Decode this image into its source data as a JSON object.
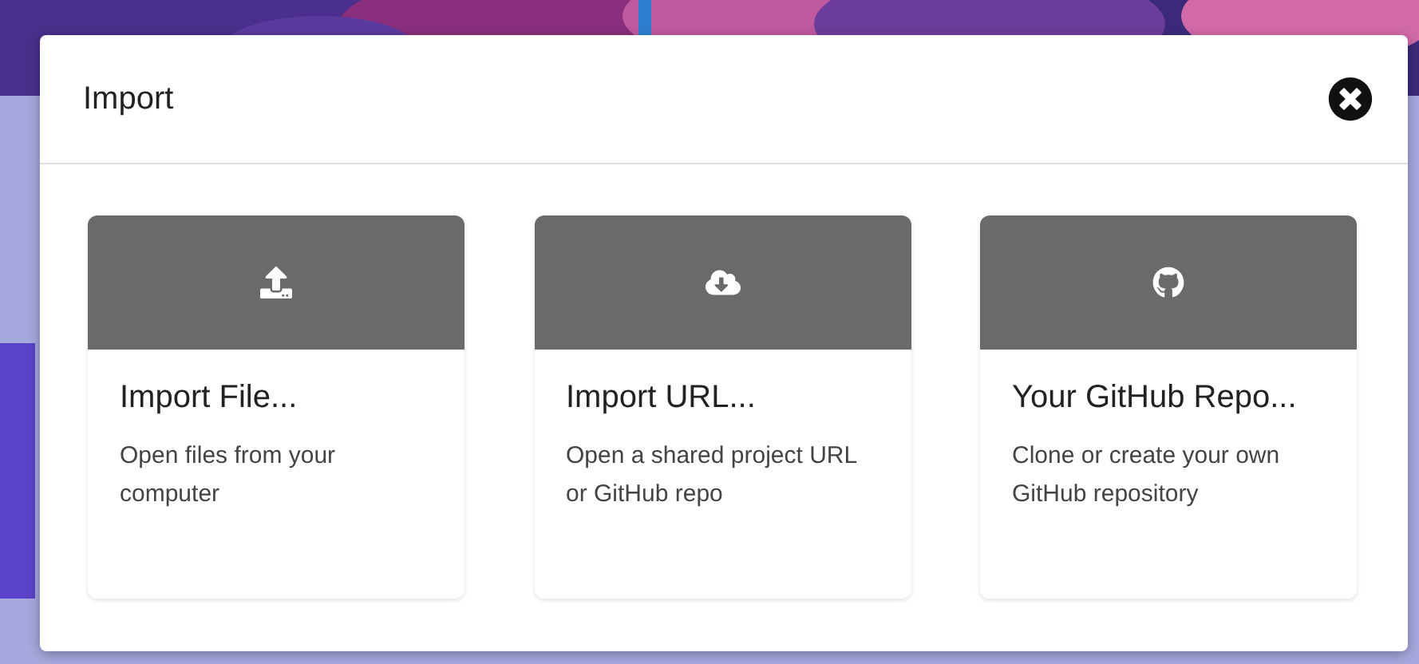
{
  "dialog": {
    "title": "Import",
    "options": [
      {
        "kind": "file",
        "title": "Import File...",
        "description": "Open files from your computer"
      },
      {
        "kind": "url",
        "title": "Import URL...",
        "description": "Open a shared project URL or GitHub repo"
      },
      {
        "kind": "github",
        "title": "Your GitHub Repo...",
        "description": "Clone or create your own GitHub repository"
      }
    ]
  }
}
